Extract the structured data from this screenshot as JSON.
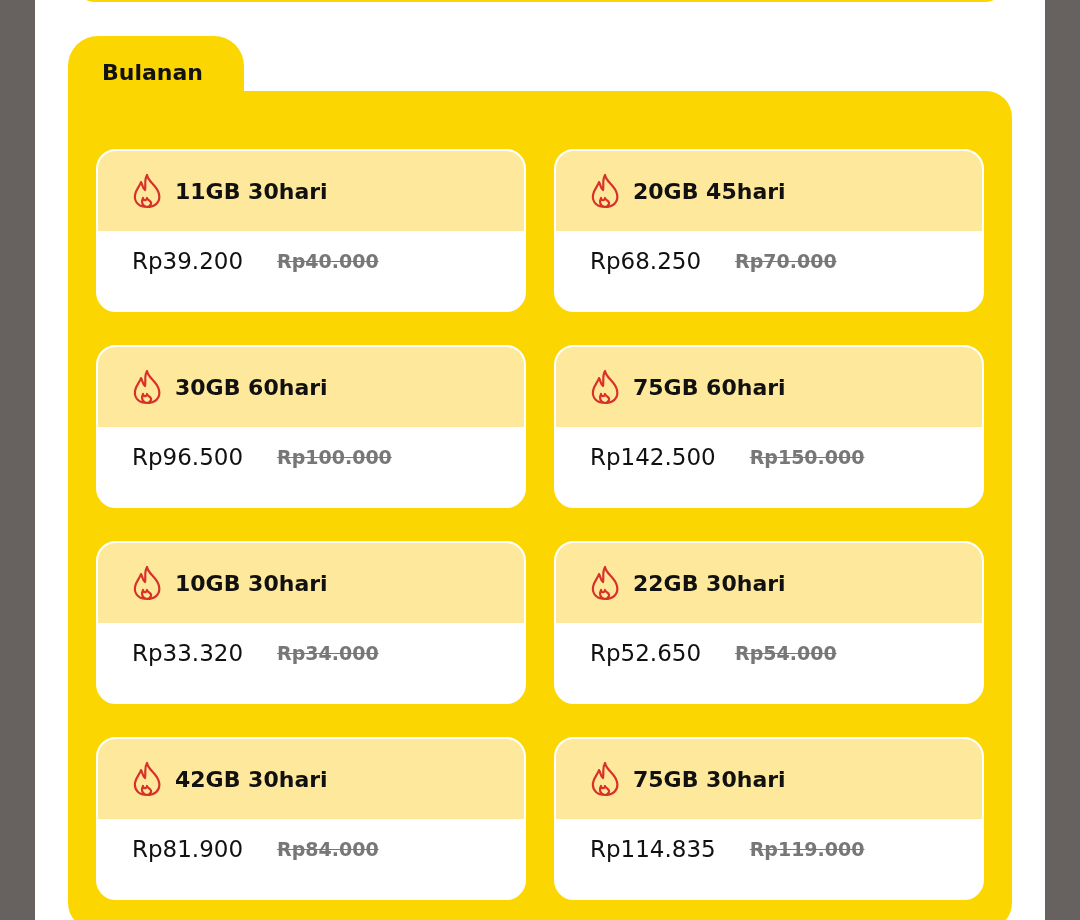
{
  "section": {
    "title": "Bulanan"
  },
  "packages": [
    {
      "name": "11GB 30hari",
      "price": "Rp39.200",
      "old_price": "Rp40.000"
    },
    {
      "name": "20GB 45hari",
      "price": "Rp68.250",
      "old_price": "Rp70.000"
    },
    {
      "name": "30GB 60hari",
      "price": "Rp96.500",
      "old_price": "Rp100.000"
    },
    {
      "name": "75GB 60hari",
      "price": "Rp142.500",
      "old_price": "Rp150.000"
    },
    {
      "name": "10GB 30hari",
      "price": "Rp33.320",
      "old_price": "Rp34.000"
    },
    {
      "name": "22GB 30hari",
      "price": "Rp52.650",
      "old_price": "Rp54.000"
    },
    {
      "name": "42GB 30hari",
      "price": "Rp81.900",
      "old_price": "Rp84.000"
    },
    {
      "name": "75GB 30hari",
      "price": "Rp114.835",
      "old_price": "Rp119.000"
    }
  ]
}
